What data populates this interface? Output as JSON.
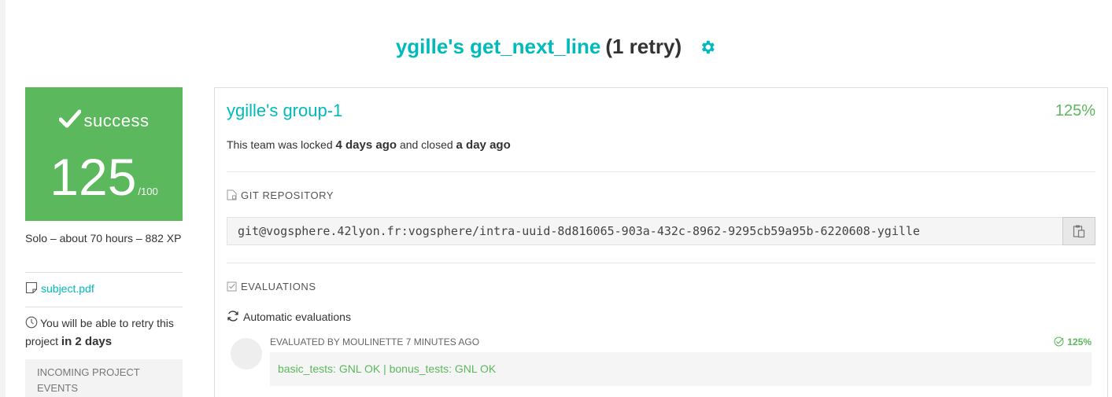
{
  "header": {
    "project_name": "ygille's get_next_line",
    "retry_count": "(1 retry)",
    "settings_icon": "gear-icon",
    "accent_color": "#00babc"
  },
  "sidebar": {
    "status": {
      "label": "success",
      "icon": "check-icon",
      "score": "125",
      "max": "/100",
      "color": "#5cb85c"
    },
    "meta": "Solo – about 70 hours – 882 XP",
    "subject": {
      "icon": "document-icon",
      "link_text": "subject.pdf"
    },
    "retry": {
      "icon": "clock-icon",
      "prefix": "You will be able to retry this project",
      "when": "in 2 days"
    },
    "incoming_events": "INCOMING PROJECT EVENTS"
  },
  "main": {
    "group_name": "ygille's group-1",
    "group_percent": "125%",
    "team_status": {
      "locked_prefix": "This team was locked",
      "locked_when": "4 days ago",
      "closed_prefix": "and closed",
      "closed_when": "a day ago"
    },
    "git": {
      "heading": "GIT REPOSITORY",
      "icon": "file-icon",
      "url": "git@vogsphere.42lyon.fr:vogsphere/intra-uuid-8d816065-903a-432c-8962-9295cb59a95b-6220608-ygille",
      "copy_icon": "clipboard-icon"
    },
    "evaluations": {
      "heading": "EVALUATIONS",
      "icon": "checkbox-icon",
      "automatic_label": "Automatic evaluations",
      "automatic_icon": "refresh-icon",
      "entry": {
        "meta": "EVALUATED BY MOULINETTE 7 MINUTES AGO",
        "score": "125%",
        "result": "basic_tests: GNL OK | bonus_tests: GNL OK"
      }
    }
  }
}
